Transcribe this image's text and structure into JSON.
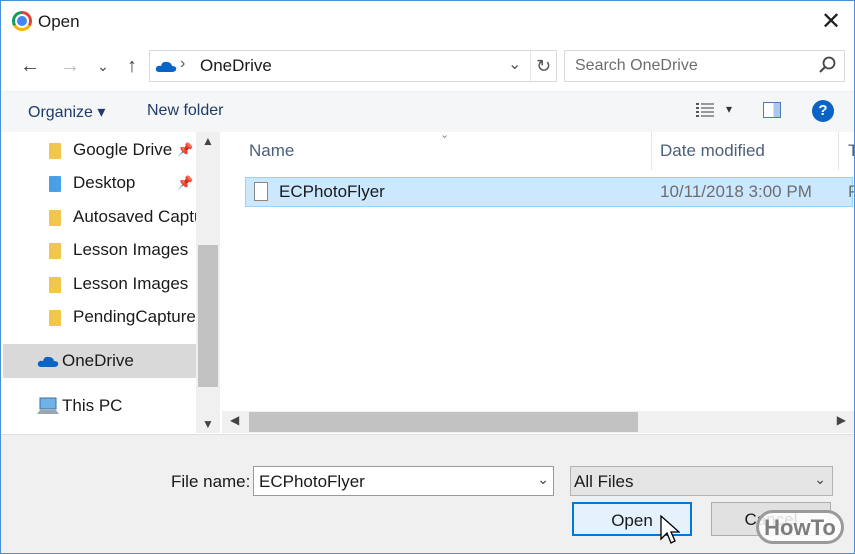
{
  "window": {
    "title": "Open",
    "close_glyph": "✕"
  },
  "nav": {
    "back_glyph": "←",
    "forward_glyph": "→",
    "recent_glyph": "⌄",
    "up_glyph": "↑"
  },
  "address": {
    "location": "OneDrive",
    "separator": "›",
    "dropdown_glyph": "⌄",
    "refresh_glyph": "↻"
  },
  "search": {
    "placeholder": "Search OneDrive"
  },
  "toolbar": {
    "organize": "Organize ▾",
    "new_folder": "New folder",
    "view_caret": "▾",
    "help": "?"
  },
  "sidebar": {
    "items": [
      {
        "label": "Google Drive",
        "pinned": true
      },
      {
        "label": "Desktop",
        "pinned": true
      },
      {
        "label": "Autosaved Captures"
      },
      {
        "label": "Lesson Images"
      },
      {
        "label": "Lesson Images"
      },
      {
        "label": "PendingCaptures"
      },
      {
        "label": "OneDrive",
        "selected": true
      },
      {
        "label": "This PC"
      }
    ],
    "pin_glyph": "📌",
    "scroll_up": "▲",
    "scroll_down": "▼"
  },
  "filelist": {
    "columns": {
      "name": "Name",
      "date": "Date modified",
      "type": "T"
    },
    "sort_glyph": "⌄",
    "rows": [
      {
        "name": "ECPhotoFlyer",
        "date": "10/11/2018 3:00 PM",
        "type": "P"
      }
    ],
    "scroll_left": "◀",
    "scroll_right": "▶"
  },
  "footer": {
    "file_name_label": "File name:",
    "file_name_value": "ECPhotoFlyer",
    "file_type": "All Files",
    "dropdown_glyph": "⌄",
    "open": "Open",
    "cancel": "Cancel"
  },
  "watermark": "HowTo",
  "colors": {
    "accent": "#0078d7",
    "selection": "#cce8ff",
    "folder": "#f2c54b",
    "onedrive": "#0a64c6"
  }
}
